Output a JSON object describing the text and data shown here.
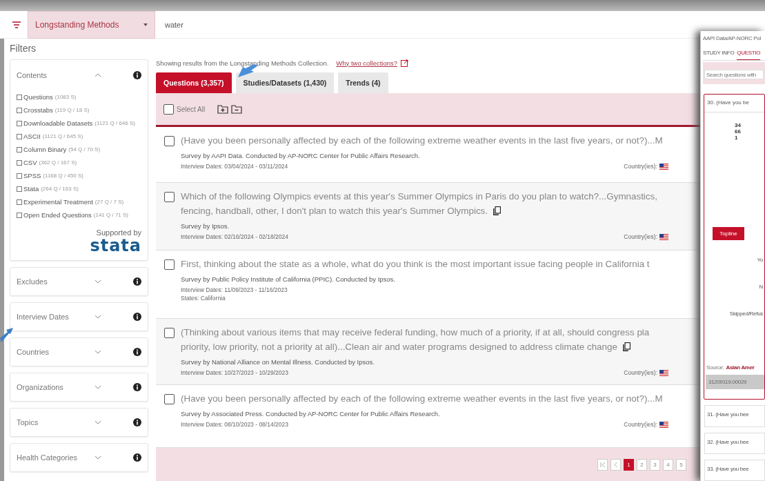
{
  "top_bar": {
    "collection": "Longstanding Methods",
    "search_value": "water"
  },
  "filters": {
    "title": "Filters",
    "sections": [
      {
        "label": "Contents",
        "expanded": true,
        "options": [
          {
            "label": "Questions",
            "count": "(1083 S)",
            "checked": false
          },
          {
            "label": "Crosstabs",
            "count": "(119 Q / 18 S)",
            "checked": false
          },
          {
            "label": "Downloadable Datasets",
            "count": "(1121 Q / 646 S)",
            "checked": false
          },
          {
            "label": "ASCII",
            "count": "(1121 Q / 645 S)",
            "checked": false
          },
          {
            "label": "Column Binary",
            "count": "(54 Q / 70 S)",
            "checked": false
          },
          {
            "label": "CSV",
            "count": "(362 Q / 167 S)",
            "checked": false
          },
          {
            "label": "SPSS",
            "count": "(1168 Q / 450 S)",
            "checked": false
          },
          {
            "label": "Stata",
            "count": "(264 Q / 163 S)",
            "checked": false
          },
          {
            "label": "Experimental Treatment",
            "count": "(27 Q / 7 S)",
            "checked": false
          },
          {
            "label": "Open Ended Questions",
            "count": "(141 Q / 71 S)",
            "checked": false
          }
        ],
        "supported_by": "Supported by",
        "logo": "stata"
      },
      {
        "label": "Excludes",
        "expanded": false
      },
      {
        "label": "Interview Dates",
        "expanded": false
      },
      {
        "label": "Countries",
        "expanded": false
      },
      {
        "label": "Organizations",
        "expanded": false
      },
      {
        "label": "Topics",
        "expanded": false
      },
      {
        "label": "Health Categories",
        "expanded": false
      }
    ]
  },
  "results": {
    "info": "Showing results from the Longstanding Methods Collection.",
    "info_link": "Why two collections?",
    "tabs": [
      {
        "label": "Questions (3,357)",
        "selected": true
      },
      {
        "label": "Studies/Datasets (1,430)",
        "selected": false
      },
      {
        "label": "Trends (4)",
        "selected": false
      }
    ],
    "select_all": {
      "label": "Select All",
      "checked": false
    },
    "rows": [
      {
        "checked": false,
        "title_lines": [
          "(Have you been personally affected by each of the following extreme weather events in the last five years, or not?)...M"
        ],
        "has_copy": false,
        "survey": "Survey by AAPI Data. Conducted by AP-NORC Center for Public Affairs Research.",
        "dates": "Interview Dates: 03/04/2024 - 03/11/2024",
        "countries_label": "Country(ies):"
      },
      {
        "checked": false,
        "title_lines": [
          "Which of the following Olympics events at this year's Summer Olympics in Paris do you plan to watch?...Gymnastics,",
          "fencing, handball, other, I don't plan to watch this year's Summer Olympics."
        ],
        "has_copy": true,
        "survey": "Survey by Ipsos.",
        "dates": "Interview Dates: 02/16/2024 - 02/18/2024",
        "countries_label": "Country(ies):"
      },
      {
        "checked": false,
        "title_lines": [
          "First, thinking about the state as a whole, what do you think is the most important issue facing people in California t"
        ],
        "has_copy": false,
        "survey": "Survey by Public Policy Institute of California (PPIC). Conducted by Ipsos.",
        "dates": "Interview Dates: 11/09/2023 - 11/16/2023",
        "states": "States: California"
      },
      {
        "checked": false,
        "title_lines": [
          "(Thinking about various items that may receive federal funding, how much of a priority, if at all, should congress pla",
          "priority, low priority, not a priority at all)...Clean air and water programs designed to address climate change"
        ],
        "has_copy": true,
        "survey": "Survey by National Alliance on Mental Illness. Conducted by Ipsos.",
        "dates": "Interview Dates: 10/27/2023 - 10/29/2023",
        "countries_label": "Country(ies):"
      },
      {
        "checked": false,
        "title_lines": [
          "(Have you been personally affected by each of the following extreme weather events in the last five years, or not?)...M"
        ],
        "has_copy": false,
        "survey": "Survey by Associated Press. Conducted by AP-NORC Center for Public Affairs Research.",
        "dates": "Interview Dates: 08/10/2023 - 08/14/2023",
        "countries_label": "Country(ies):"
      }
    ],
    "pages": [
      {
        "label": "1",
        "selected": true
      },
      {
        "label": "2",
        "selected": false
      },
      {
        "label": "3",
        "selected": false
      },
      {
        "label": "4",
        "selected": false
      },
      {
        "label": "5",
        "selected": false
      }
    ]
  },
  "side_window": {
    "title": "AAPI Data/AP-NORC Pol",
    "tabs": [
      {
        "label": "STUDY INFO",
        "selected": false
      },
      {
        "label": "QUESTIO",
        "selected": true
      }
    ],
    "search_placeholder": "Search questions with",
    "question": "30. (Have you be",
    "numbers": [
      "34",
      "66",
      "1"
    ],
    "topline": "Topline",
    "answers": [
      "Yo",
      "N",
      "Skipped/Refus"
    ],
    "source_label": "Source:",
    "source": "Asian Amer",
    "id": "31209119.00029",
    "more_questions": [
      "31. (Have you bee",
      "32. (Have you bee",
      "33. (Have you bee"
    ]
  }
}
